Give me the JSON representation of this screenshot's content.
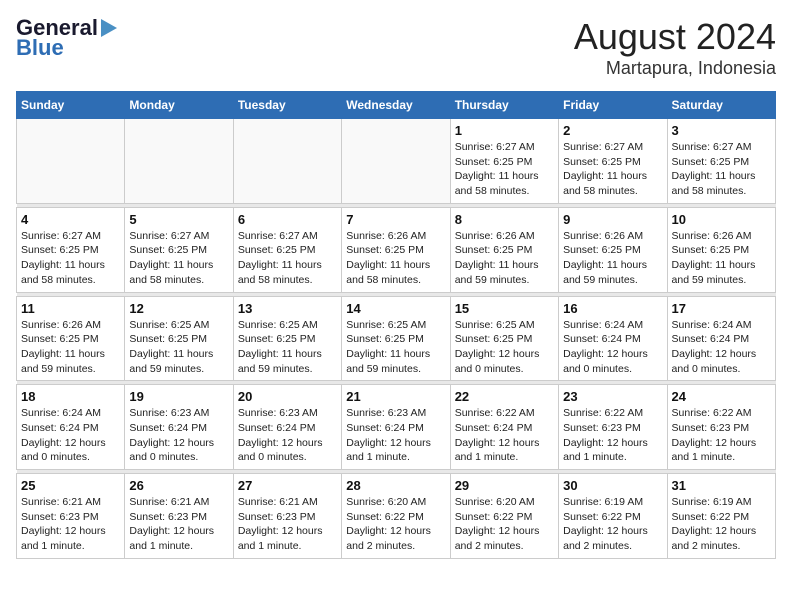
{
  "header": {
    "logo_line1": "General",
    "logo_line2": "Blue",
    "title": "August 2024",
    "subtitle": "Martapura, Indonesia"
  },
  "weekdays": [
    "Sunday",
    "Monday",
    "Tuesday",
    "Wednesday",
    "Thursday",
    "Friday",
    "Saturday"
  ],
  "weeks": [
    [
      {
        "day": "",
        "info": ""
      },
      {
        "day": "",
        "info": ""
      },
      {
        "day": "",
        "info": ""
      },
      {
        "day": "",
        "info": ""
      },
      {
        "day": "1",
        "info": "Sunrise: 6:27 AM\nSunset: 6:25 PM\nDaylight: 11 hours\nand 58 minutes."
      },
      {
        "day": "2",
        "info": "Sunrise: 6:27 AM\nSunset: 6:25 PM\nDaylight: 11 hours\nand 58 minutes."
      },
      {
        "day": "3",
        "info": "Sunrise: 6:27 AM\nSunset: 6:25 PM\nDaylight: 11 hours\nand 58 minutes."
      }
    ],
    [
      {
        "day": "4",
        "info": "Sunrise: 6:27 AM\nSunset: 6:25 PM\nDaylight: 11 hours\nand 58 minutes."
      },
      {
        "day": "5",
        "info": "Sunrise: 6:27 AM\nSunset: 6:25 PM\nDaylight: 11 hours\nand 58 minutes."
      },
      {
        "day": "6",
        "info": "Sunrise: 6:27 AM\nSunset: 6:25 PM\nDaylight: 11 hours\nand 58 minutes."
      },
      {
        "day": "7",
        "info": "Sunrise: 6:26 AM\nSunset: 6:25 PM\nDaylight: 11 hours\nand 58 minutes."
      },
      {
        "day": "8",
        "info": "Sunrise: 6:26 AM\nSunset: 6:25 PM\nDaylight: 11 hours\nand 59 minutes."
      },
      {
        "day": "9",
        "info": "Sunrise: 6:26 AM\nSunset: 6:25 PM\nDaylight: 11 hours\nand 59 minutes."
      },
      {
        "day": "10",
        "info": "Sunrise: 6:26 AM\nSunset: 6:25 PM\nDaylight: 11 hours\nand 59 minutes."
      }
    ],
    [
      {
        "day": "11",
        "info": "Sunrise: 6:26 AM\nSunset: 6:25 PM\nDaylight: 11 hours\nand 59 minutes."
      },
      {
        "day": "12",
        "info": "Sunrise: 6:25 AM\nSunset: 6:25 PM\nDaylight: 11 hours\nand 59 minutes."
      },
      {
        "day": "13",
        "info": "Sunrise: 6:25 AM\nSunset: 6:25 PM\nDaylight: 11 hours\nand 59 minutes."
      },
      {
        "day": "14",
        "info": "Sunrise: 6:25 AM\nSunset: 6:25 PM\nDaylight: 11 hours\nand 59 minutes."
      },
      {
        "day": "15",
        "info": "Sunrise: 6:25 AM\nSunset: 6:25 PM\nDaylight: 12 hours\nand 0 minutes."
      },
      {
        "day": "16",
        "info": "Sunrise: 6:24 AM\nSunset: 6:24 PM\nDaylight: 12 hours\nand 0 minutes."
      },
      {
        "day": "17",
        "info": "Sunrise: 6:24 AM\nSunset: 6:24 PM\nDaylight: 12 hours\nand 0 minutes."
      }
    ],
    [
      {
        "day": "18",
        "info": "Sunrise: 6:24 AM\nSunset: 6:24 PM\nDaylight: 12 hours\nand 0 minutes."
      },
      {
        "day": "19",
        "info": "Sunrise: 6:23 AM\nSunset: 6:24 PM\nDaylight: 12 hours\nand 0 minutes."
      },
      {
        "day": "20",
        "info": "Sunrise: 6:23 AM\nSunset: 6:24 PM\nDaylight: 12 hours\nand 0 minutes."
      },
      {
        "day": "21",
        "info": "Sunrise: 6:23 AM\nSunset: 6:24 PM\nDaylight: 12 hours\nand 1 minute."
      },
      {
        "day": "22",
        "info": "Sunrise: 6:22 AM\nSunset: 6:24 PM\nDaylight: 12 hours\nand 1 minute."
      },
      {
        "day": "23",
        "info": "Sunrise: 6:22 AM\nSunset: 6:23 PM\nDaylight: 12 hours\nand 1 minute."
      },
      {
        "day": "24",
        "info": "Sunrise: 6:22 AM\nSunset: 6:23 PM\nDaylight: 12 hours\nand 1 minute."
      }
    ],
    [
      {
        "day": "25",
        "info": "Sunrise: 6:21 AM\nSunset: 6:23 PM\nDaylight: 12 hours\nand 1 minute."
      },
      {
        "day": "26",
        "info": "Sunrise: 6:21 AM\nSunset: 6:23 PM\nDaylight: 12 hours\nand 1 minute."
      },
      {
        "day": "27",
        "info": "Sunrise: 6:21 AM\nSunset: 6:23 PM\nDaylight: 12 hours\nand 1 minute."
      },
      {
        "day": "28",
        "info": "Sunrise: 6:20 AM\nSunset: 6:22 PM\nDaylight: 12 hours\nand 2 minutes."
      },
      {
        "day": "29",
        "info": "Sunrise: 6:20 AM\nSunset: 6:22 PM\nDaylight: 12 hours\nand 2 minutes."
      },
      {
        "day": "30",
        "info": "Sunrise: 6:19 AM\nSunset: 6:22 PM\nDaylight: 12 hours\nand 2 minutes."
      },
      {
        "day": "31",
        "info": "Sunrise: 6:19 AM\nSunset: 6:22 PM\nDaylight: 12 hours\nand 2 minutes."
      }
    ]
  ]
}
